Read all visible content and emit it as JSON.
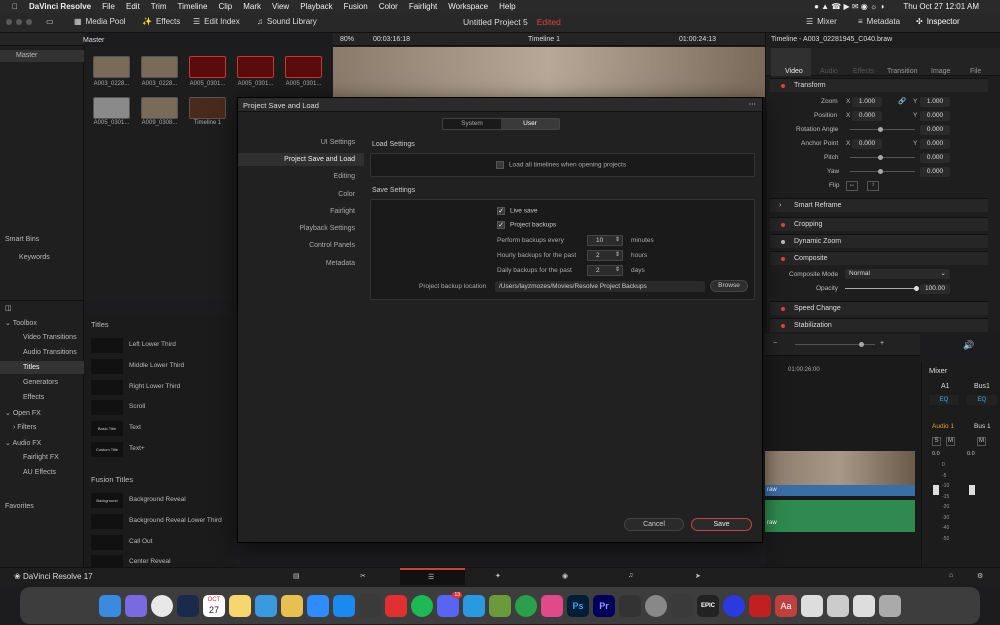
{
  "menubar": {
    "app": "DaVinci Resolve",
    "items": [
      "File",
      "Edit",
      "Trim",
      "Timeline",
      "Clip",
      "Mark",
      "View",
      "Playback",
      "Fusion",
      "Color",
      "Fairlight",
      "Workspace",
      "Help"
    ],
    "clock": "Thu Oct 27  12:01 AM"
  },
  "toolbar": {
    "media_pool": "Media Pool",
    "effects": "Effects",
    "edit_index": "Edit Index",
    "sound_library": "Sound Library",
    "project_title": "Untitled Project 5",
    "edited": "Edited",
    "mixer": "Mixer",
    "metadata": "Metadata",
    "inspector": "Inspector"
  },
  "media": {
    "bin": "Master",
    "zoom": "80%",
    "timecode": "00:03:16:18",
    "timeline_name": "Timeline 1",
    "timeline_tc": "01:00:24:13",
    "clips": [
      "A003_0228...",
      "A003_0228...",
      "A005_0301...",
      "A005_0301...",
      "A005_0301...",
      "A005_0301...",
      "A009_0308...",
      "Timeline 1"
    ]
  },
  "sidebar": {
    "master": "Master",
    "smart_bins": "Smart Bins",
    "keywords": "Keywords",
    "favorites": "Favorites"
  },
  "toolbox": {
    "items": [
      "Toolbox",
      "Video Transitions",
      "Audio Transitions",
      "Titles",
      "Generators",
      "Effects",
      "Open FX",
      "Filters",
      "Audio FX",
      "Fairlight FX",
      "AU Effects"
    ]
  },
  "titles": {
    "header": "Titles",
    "list": [
      "Left Lower Third",
      "Middle Lower Third",
      "Right Lower Third",
      "Scroll",
      "Text",
      "Text+"
    ],
    "thumb_text": [
      "",
      "",
      "",
      "",
      "Basic Title",
      "Custom Title"
    ],
    "fusion_header": "Fusion Titles",
    "fusion_list": [
      "Background Reveal",
      "Background Reveal Lower Third",
      "Call Out",
      "Center Reveal"
    ],
    "fusion_thumb_text": "Background Reveal"
  },
  "dialog": {
    "title": "Project Save and Load",
    "tabs": [
      "System",
      "User"
    ],
    "nav": [
      "UI Settings",
      "Project Save and Load",
      "Editing",
      "Color",
      "Fairlight",
      "Playback Settings",
      "Control Panels",
      "Metadata"
    ],
    "load_settings": "Load Settings",
    "load_all": "Load all timelines when opening projects",
    "save_settings": "Save Settings",
    "live_save": "Live save",
    "project_backups": "Project backups",
    "perform_backups": "Perform backups every",
    "perform_value": "10",
    "perform_unit": "minutes",
    "hourly": "Hourly backups for the past",
    "hourly_value": "2",
    "hourly_unit": "hours",
    "daily": "Daily backups for the past",
    "daily_value": "2",
    "daily_unit": "days",
    "backup_location_label": "Project backup location",
    "backup_location": "/Users/layzmozes/Movies/Resolve Project Backups",
    "browse": "Browse",
    "cancel": "Cancel",
    "save": "Save"
  },
  "inspector": {
    "clip_name": "Timeline - A003_02281945_C040.braw",
    "tabs": [
      "Video",
      "Audio",
      "Effects",
      "Transition",
      "Image",
      "File"
    ],
    "transform": "Transform",
    "zoom_label": "Zoom",
    "zoom_x": "1.000",
    "zoom_y": "1.000",
    "position_label": "Position",
    "pos_x": "0.000",
    "pos_y": "0.000",
    "rotation_label": "Rotation Angle",
    "rotation": "0.000",
    "anchor_label": "Anchor Point",
    "anchor_x": "0.000",
    "anchor_y": "0.000",
    "pitch_label": "Pitch",
    "pitch": "0.000",
    "yaw_label": "Yaw",
    "yaw": "0.000",
    "flip_label": "Flip",
    "smart_reframe": "Smart Reframe",
    "cropping": "Cropping",
    "dynamic_zoom": "Dynamic Zoom",
    "composite": "Composite",
    "composite_mode_label": "Composite Mode",
    "composite_mode": "Normal",
    "opacity_label": "Opacity",
    "opacity": "100.00",
    "speed_change": "Speed Change",
    "stabilization": "Stabilization"
  },
  "mixer": {
    "title": "Mixer",
    "ch1": "A1",
    "ch2": "Bus1",
    "eq": "EQ",
    "audio1": "Audio 1",
    "bus1": "Bus 1",
    "s": "S",
    "m": "M",
    "zero": "0.0",
    "scale": [
      "0",
      "-5",
      "-10",
      "-15",
      "-20",
      "-30",
      "-40",
      "-50"
    ]
  },
  "timeline": {
    "ruler": "01:00:26:00",
    "clip_label": "raw"
  },
  "footer": {
    "app_name": "DaVinci Resolve 17"
  },
  "dock": {
    "calendar_month": "OCT",
    "calendar_day": "27",
    "badge": "13",
    "ps": "Ps",
    "pr": "Pr",
    "aa": "Aa",
    "epic": "EPIC"
  }
}
